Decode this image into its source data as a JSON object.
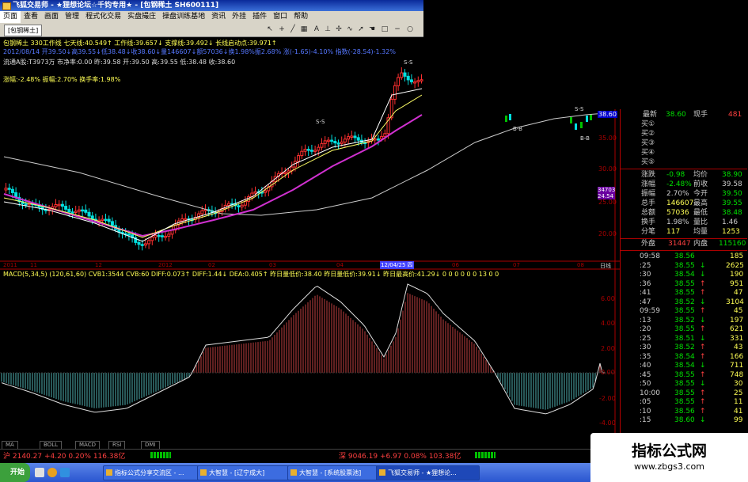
{
  "window": {
    "title": "飞狐交易师 - ★狸想论坛☆千钧专用★ - [包钢稀土 SH600111]",
    "menu": [
      "页面",
      "查看",
      "画面",
      "管理",
      "程式化交易",
      "技术分析",
      "实盘撮庄",
      "技术分析",
      "操盘训练基地",
      "资讯",
      "外挂",
      "插件",
      "窗口",
      "帮助"
    ],
    "toolbar_title": "[包钢稀土]"
  },
  "upper_info": {
    "line1": "包钢稀土  330工作线  七天线:40.549↑  工作线:39.657↓  支撑线:39.492↓  长线启动点:39.971↑",
    "line2": "2012/08/14  开39.50↓高39.55↓低38.48↓收38.60↓量146607↓额57036↓换1.98%振2.68%  涨(-1.65)-4.10%  指数(-28.54)-1.32%",
    "line3": "流通A股:T3973万  市净率:0.00  昨:39.58  开:39.50  高:39.55  低:38.48  收:38.60",
    "line4": "涨幅:-2.48%  振幅:2.70%  换手率:1.98%"
  },
  "upper_axis": [
    "38.60",
    "35.00",
    "30.00",
    "25.00",
    "20.00"
  ],
  "upper_axis_tag": "34703\n24.54",
  "chart_annotations": [
    "S-S",
    "S-S",
    "S-S",
    "B-B",
    "B-B"
  ],
  "date_axis": [
    "2011",
    "11",
    "12",
    "2012",
    "02",
    "03",
    "04",
    "12/04/25 四",
    "06",
    "07",
    "08",
    "日线"
  ],
  "macd_info": "MACD(5,34,5)  (120,61,60)  CVB1:3544  CVB:60  DIFF:0.073↑  DIFF:1.44↓  DEA:0.405↑  昨日量低价:38.40  昨日量低价:39.91↓  昨日最高价:41.29↓  0 0 0 0 0 0 13 0 0",
  "macd_axis": [
    "6.00",
    "4.00",
    "2.00",
    "0.00",
    "-2.00",
    "-4.00"
  ],
  "bottom_tabs": [
    "MA",
    "BOLL",
    "MACD",
    "RSI",
    "DMI"
  ],
  "quote": {
    "top": {
      "label": "最新",
      "price": "38.60",
      "side": "现手",
      "vol": "481"
    },
    "sells": [
      "买①",
      "买②",
      "买③",
      "买④",
      "买⑤"
    ],
    "rows": [
      {
        "l": "涨跌",
        "v": "-0.98",
        "l2": "均价",
        "v2": "38.90"
      },
      {
        "l": "涨幅",
        "v": "-2.48%",
        "l2": "前收",
        "v2": "39.58"
      },
      {
        "l": "振幅",
        "v": "2.70%",
        "l2": "今开",
        "v2": "39.50"
      },
      {
        "l": "总手",
        "v": "146607",
        "l2": "最高",
        "v2": "39.55"
      },
      {
        "l": "总额",
        "v": "57036",
        "l2": "最低",
        "v2": "38.48"
      },
      {
        "l": "换手",
        "v": "1.98%",
        "l2": "量比",
        "v2": "1.46"
      },
      {
        "l": "分笔",
        "v": "117",
        "l2": "均量",
        "v2": "1253"
      }
    ],
    "outer": {
      "l": "外盘",
      "v": "31447",
      "l2": "内盘",
      "v2": "115160"
    }
  },
  "ticks": [
    {
      "t": "09:58",
      "p": "38.56",
      "d": "",
      "v": "185"
    },
    {
      "t": ":25",
      "p": "38.55",
      "d": "↓",
      "v": "2625"
    },
    {
      "t": ":30",
      "p": "38.54",
      "d": "↓",
      "v": "190"
    },
    {
      "t": ":36",
      "p": "38.55",
      "d": "↑",
      "v": "951"
    },
    {
      "t": ":41",
      "p": "38.55",
      "d": "↑",
      "v": "47"
    },
    {
      "t": ":47",
      "p": "38.52",
      "d": "↓",
      "v": "3104"
    },
    {
      "t": "09:59",
      "p": "38.55",
      "d": "↑",
      "v": "45"
    },
    {
      "t": ":13",
      "p": "38.52",
      "d": "↓",
      "v": "197"
    },
    {
      "t": ":20",
      "p": "38.55",
      "d": "↑",
      "v": "621"
    },
    {
      "t": ":25",
      "p": "38.51",
      "d": "↓",
      "v": "331"
    },
    {
      "t": ":30",
      "p": "38.52",
      "d": "↑",
      "v": "43"
    },
    {
      "t": ":35",
      "p": "38.54",
      "d": "↑",
      "v": "166"
    },
    {
      "t": ":40",
      "p": "38.54",
      "d": "↓",
      "v": "711"
    },
    {
      "t": ":45",
      "p": "38.55",
      "d": "↑",
      "v": "748"
    },
    {
      "t": ":50",
      "p": "38.55",
      "d": "↓",
      "v": "30"
    },
    {
      "t": "10:00",
      "p": "38.55",
      "d": "↑",
      "v": "25"
    },
    {
      "t": ":05",
      "p": "38.55",
      "d": "↑",
      "v": "11"
    },
    {
      "t": ":10",
      "p": "38.56",
      "d": "↑",
      "v": "41"
    },
    {
      "t": ":15",
      "p": "38.60",
      "d": "↓",
      "v": "99"
    }
  ],
  "status": {
    "sh": "沪 2140.27 +4.20 0.20% 116.38亿",
    "sz": "深 9046.19 +6.97 0.08% 103.38亿"
  },
  "taskbar": {
    "start": "开始",
    "items": [
      "指标公式分享交流区 - ...",
      "大智慧 - [辽宁成大]",
      "大智慧 - [系统股票池]",
      "飞狐交易师 - ★狸想论..."
    ]
  },
  "watermark": {
    "line1": "指标公式网",
    "line2": "www.zbgs3.com"
  },
  "colors": {
    "up": "#ff3030",
    "down": "#00e0e0",
    "ma_yellow": "#ffff66",
    "ma_magenta": "#d030d0",
    "ma_white": "#cccccc",
    "panel_border": "#b00000"
  }
}
